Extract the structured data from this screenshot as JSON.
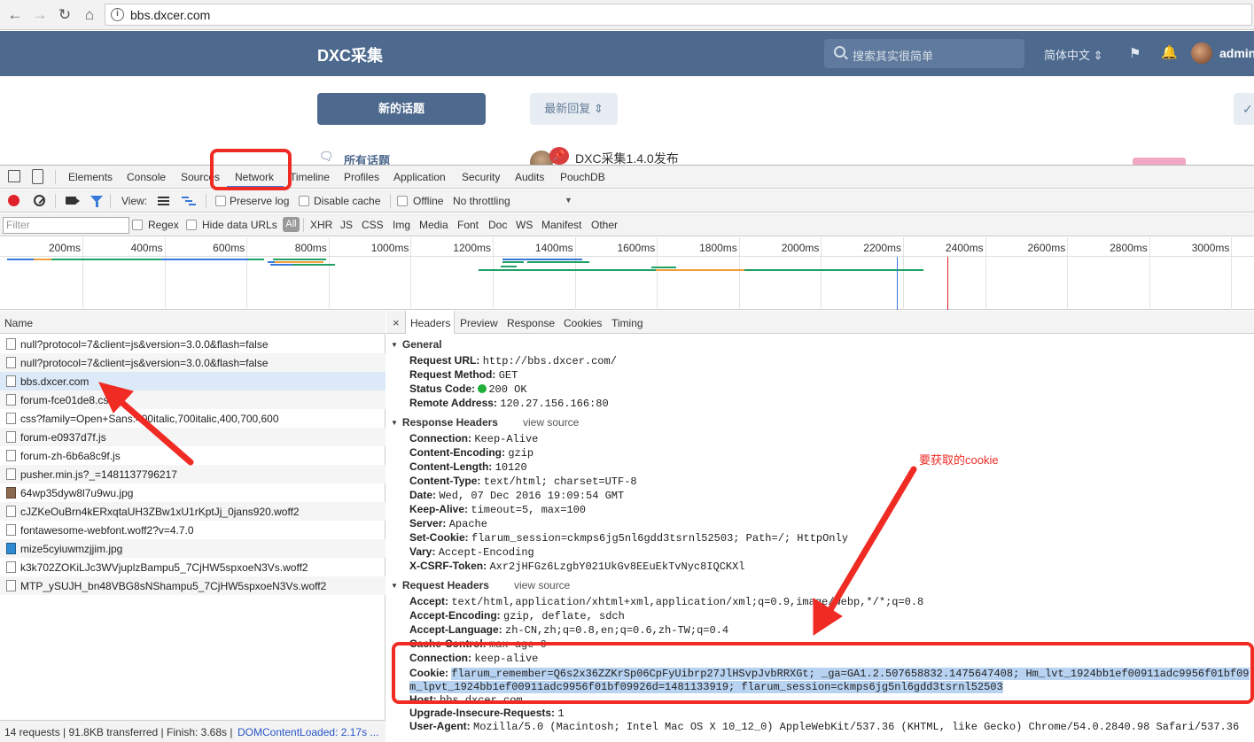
{
  "browser": {
    "url": "bbs.dxcer.com"
  },
  "forum": {
    "title": "DXC采集",
    "search_placeholder": "搜索其实很简单",
    "language": "简体中文",
    "username": "admin",
    "new_topic_label": "新的话题",
    "sort_label": "最新回复",
    "all_topics_label": "所有话题",
    "pinned_post_title": "DXC采集1.4.0发布"
  },
  "devtools": {
    "tabs": [
      "Elements",
      "Console",
      "Sources",
      "Network",
      "Timeline",
      "Profiles",
      "Application",
      "Security",
      "Audits",
      "PouchDB"
    ],
    "active_tab": "Network",
    "toolbar": {
      "view_label": "View:",
      "preserve_log": "Preserve log",
      "disable_cache": "Disable cache",
      "offline": "Offline",
      "throttling": "No throttling"
    },
    "filter": {
      "placeholder": "Filter",
      "regex": "Regex",
      "hide_data_urls": "Hide data URLs",
      "all": "All",
      "types": [
        "XHR",
        "JS",
        "CSS",
        "Img",
        "Media",
        "Font",
        "Doc",
        "WS",
        "Manifest",
        "Other"
      ]
    },
    "timeline_ticks": [
      "200ms",
      "400ms",
      "600ms",
      "800ms",
      "1000ms",
      "1200ms",
      "1400ms",
      "1600ms",
      "1800ms",
      "2000ms",
      "2200ms",
      "2400ms",
      "2600ms",
      "2800ms",
      "3000ms"
    ],
    "requests": {
      "header": "Name",
      "items": [
        "null?protocol=7&client=js&version=3.0.0&flash=false",
        "null?protocol=7&client=js&version=3.0.0&flash=false",
        "bbs.dxcer.com",
        "forum-fce01de8.css",
        "css?family=Open+Sans:400italic,700italic,400,700,600",
        "forum-e0937d7f.js",
        "forum-zh-6b6a8c9f.js",
        "pusher.min.js?_=1481137796217",
        "64wp35dyw8l7u9wu.jpg",
        "cJZKeOuBrn4kERxqtaUH3ZBw1xU1rKptJj_0jans920.woff2",
        "fontawesome-webfont.woff2?v=4.7.0",
        "mize5cyiuwmzjjim.jpg",
        "k3k702ZOKiLJc3WVjuplzBampu5_7CjHW5spxoeN3Vs.woff2",
        "MTP_ySUJH_bn48VBG8sNShampu5_7CjHW5spxoeN3Vs.woff2"
      ],
      "selected_index": 2
    },
    "status": {
      "summary": "14 requests | 91.8KB transferred | Finish: 3.68s | ",
      "dom_loaded": "DOMContentLoaded: 2.17s ..."
    },
    "detail_tabs": [
      "Headers",
      "Preview",
      "Response",
      "Cookies",
      "Timing"
    ],
    "close": "×",
    "general": {
      "title": "General",
      "rows": [
        {
          "k": "Request URL:",
          "v": "http://bbs.dxcer.com/"
        },
        {
          "k": "Request Method:",
          "v": "GET"
        },
        {
          "k": "Status Code:",
          "v": "200 OK"
        },
        {
          "k": "Remote Address:",
          "v": "120.27.156.166:80"
        }
      ]
    },
    "response_headers": {
      "title": "Response Headers",
      "view_source": "view source",
      "rows": [
        {
          "k": "Connection:",
          "v": "Keep-Alive"
        },
        {
          "k": "Content-Encoding:",
          "v": "gzip"
        },
        {
          "k": "Content-Length:",
          "v": "10120"
        },
        {
          "k": "Content-Type:",
          "v": "text/html; charset=UTF-8"
        },
        {
          "k": "Date:",
          "v": "Wed, 07 Dec 2016 19:09:54 GMT"
        },
        {
          "k": "Keep-Alive:",
          "v": "timeout=5, max=100"
        },
        {
          "k": "Server:",
          "v": "Apache"
        },
        {
          "k": "Set-Cookie:",
          "v": "flarum_session=ckmps6jg5nl6gdd3tsrnl52503; Path=/; HttpOnly"
        },
        {
          "k": "Vary:",
          "v": "Accept-Encoding"
        },
        {
          "k": "X-CSRF-Token:",
          "v": "Axr2jHFGz6LzgbY021UkGv8EEuEkTvNyc8IQCKXl"
        }
      ]
    },
    "request_headers": {
      "title": "Request Headers",
      "view_source": "view source",
      "rows": [
        {
          "k": "Accept:",
          "v": "text/html,application/xhtml+xml,application/xml;q=0.9,image/webp,*/*;q=0.8"
        },
        {
          "k": "Accept-Encoding:",
          "v": "gzip, deflate, sdch"
        },
        {
          "k": "Accept-Language:",
          "v": "zh-CN,zh;q=0.8,en;q=0.6,zh-TW;q=0.4"
        },
        {
          "k": "Cache-Control:",
          "v": "max-age=0"
        },
        {
          "k": "Connection:",
          "v": "keep-alive"
        }
      ],
      "cookie_key": "Cookie:",
      "cookie_line1": "flarum_remember=Q6s2x36ZZKrSp06CpFyUibrp27JlHSvpJvbRRXGt; _ga=GA1.2.507658832.1475647408; Hm_lvt_1924bb1ef00911adc9956f01bf09",
      "cookie_line2": "m_lpvt_1924bb1ef00911adc9956f01bf09926d=1481133919; flarum_session=ckmps6jg5nl6gdd3tsrnl52503",
      "rows_after": [
        {
          "k": "Host:",
          "v": "bbs.dxcer.com"
        },
        {
          "k": "Upgrade-Insecure-Requests:",
          "v": "1"
        },
        {
          "k": "User-Agent:",
          "v": "Mozilla/5.0 (Macintosh; Intel Mac OS X 10_12_0) AppleWebKit/537.36 (KHTML, like Gecko) Chrome/54.0.2840.98 Safari/537.36"
        }
      ]
    }
  },
  "annotation": {
    "cookie_label": "要获取的cookie",
    "color": "#ef2b24"
  }
}
